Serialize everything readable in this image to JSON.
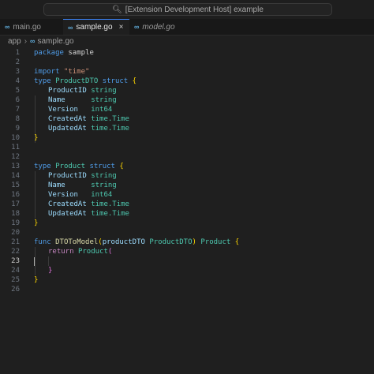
{
  "window": {
    "search_text": "[Extension Development Host] example"
  },
  "tabs": [
    {
      "label": "main.go",
      "icon": "go-file-icon",
      "active": false,
      "italic": false
    },
    {
      "label": "sample.go",
      "icon": "go-file-icon",
      "active": true,
      "italic": false
    },
    {
      "label": "model.go",
      "icon": "go-file-icon",
      "active": false,
      "italic": true
    }
  ],
  "tab_icon_glyph": "∞",
  "tab_close_glyph": "×",
  "breadcrumb": {
    "folder": "app",
    "file": "sample.go"
  },
  "gutter": [
    "1",
    "2",
    "3",
    "4",
    "5",
    "6",
    "7",
    "8",
    "9",
    "10",
    "11",
    "12",
    "13",
    "14",
    "15",
    "16",
    "17",
    "18",
    "19",
    "20",
    "21",
    "22",
    "23",
    "24",
    "25",
    "26"
  ],
  "code": {
    "l1": [
      "package",
      " sample"
    ],
    "l3": [
      "import",
      " ",
      "\"time\""
    ],
    "l4": [
      "type",
      " ",
      "ProductDTO",
      " ",
      "struct",
      " ",
      "{"
    ],
    "l5": [
      "ProductID",
      " ",
      "string"
    ],
    "l6": [
      "Name",
      "      ",
      "string"
    ],
    "l7": [
      "Version",
      "   ",
      "int64"
    ],
    "l8": [
      "CreatedAt",
      " ",
      "time.Time"
    ],
    "l9": [
      "UpdatedAt",
      " ",
      "time.Time"
    ],
    "l10": [
      "}"
    ],
    "l13": [
      "type",
      " ",
      "Product",
      " ",
      "struct",
      " ",
      "{"
    ],
    "l14": [
      "ProductID",
      " ",
      "string"
    ],
    "l15": [
      "Name",
      "      ",
      "string"
    ],
    "l16": [
      "Version",
      "   ",
      "int64"
    ],
    "l17": [
      "CreatedAt",
      " ",
      "time.Time"
    ],
    "l18": [
      "UpdatedAt",
      " ",
      "time.Time"
    ],
    "l19": [
      "}"
    ],
    "l21": [
      "func",
      " ",
      "DTOToModel",
      "(",
      "productDTO",
      " ",
      "ProductDTO",
      ")",
      " ",
      "Product",
      " ",
      "{"
    ],
    "l22": [
      "return",
      " ",
      "Product",
      "("
    ],
    "l24": [
      "}"
    ],
    "l25": [
      "}"
    ]
  },
  "colors": {
    "keyword": "#4f9ce8",
    "control_keyword": "#c586c0",
    "string": "#ce9178",
    "type": "#4ec9b0",
    "function": "#dcdcaa",
    "bracket_gold": "#ffd700",
    "bracket_pink": "#da70d6",
    "active_tab_border": "#3b82f6"
  }
}
